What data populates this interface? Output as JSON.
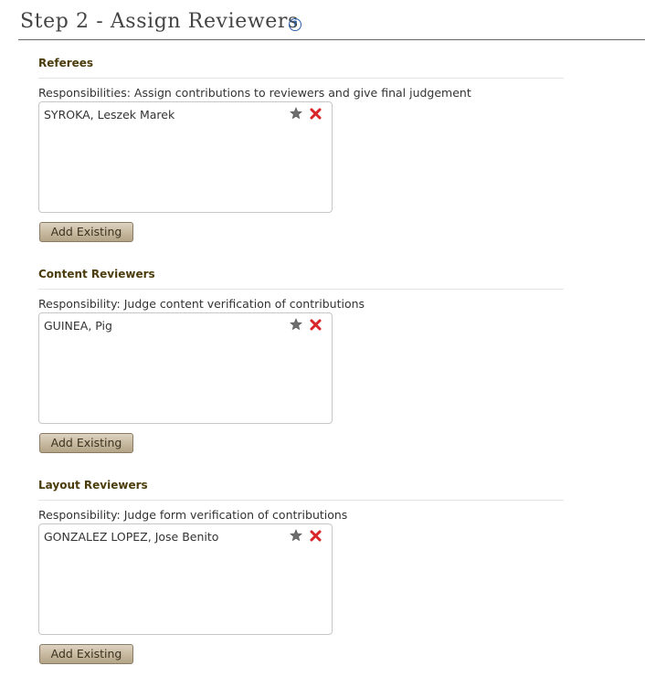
{
  "page": {
    "title": "Step 2 - Assign Reviewers",
    "help_icon": "?"
  },
  "sections": [
    {
      "title": "Referees",
      "description": "Responsibilities: Assign contributions to reviewers and give final judgement",
      "reviewers": [
        "SYROKA, Leszek Marek"
      ],
      "button_label": "Add Existing"
    },
    {
      "title": "Content Reviewers",
      "description": "Responsibility: Judge content verification of contributions",
      "reviewers": [
        "GUINEA, Pig"
      ],
      "button_label": "Add Existing"
    },
    {
      "title": "Layout Reviewers",
      "description": "Responsibility: Judge form verification of contributions",
      "reviewers": [
        "GONZALEZ LOPEZ, Jose Benito"
      ],
      "button_label": "Add Existing"
    }
  ],
  "icons": {
    "star": "star-icon",
    "remove": "remove-icon",
    "help": "help-icon"
  },
  "colors": {
    "section_title": "#4b3c0c",
    "star": "#6e6e6e",
    "remove": "#d9262a",
    "help": "#2a5ea8",
    "button_fill": "#c6b89e"
  }
}
